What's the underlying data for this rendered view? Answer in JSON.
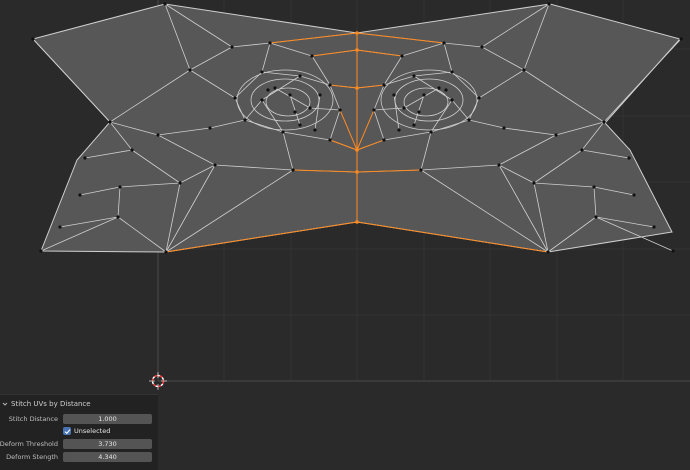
{
  "panel": {
    "title": "Stitch UVs by Distance",
    "fields": [
      {
        "label": "Stitch Distance",
        "value": "1.000"
      },
      {
        "label": "Deform Threshold",
        "value": "3.730"
      },
      {
        "label": "Deform Stength",
        "value": "4.340"
      }
    ],
    "checkbox": {
      "label": "Unselected",
      "checked": true
    }
  },
  "colors": {
    "background": "#2a2a2a",
    "mesh_face": "#555555",
    "mesh_edge": "#c8c8c8",
    "selected_edge": "#ff8a1f",
    "vertex": "#111111",
    "checkbox_accent": "#4772b3"
  },
  "icons": {
    "cursor": "3d-cursor-icon",
    "collapse": "chevron-down-icon",
    "check": "check-icon"
  }
}
